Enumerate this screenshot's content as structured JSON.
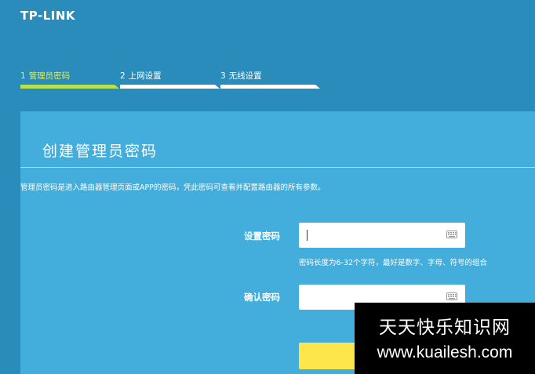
{
  "brand": {
    "logo_text": "TP-LINK"
  },
  "steps": [
    {
      "number": "1",
      "label": "管理员密码",
      "active": true
    },
    {
      "number": "2",
      "label": "上网设置",
      "active": false
    },
    {
      "number": "3",
      "label": "无线设置",
      "active": false
    }
  ],
  "panel": {
    "title": "创建管理员密码",
    "description": "管理员密码是进入路由器管理页面或APP的密码，凭此密码可查看并配置路由器的所有参数。",
    "fields": {
      "set_password": {
        "label": "设置密码",
        "value": "",
        "hint": "密码长度为6-32个字符，最好是数字、字母、符号的组合"
      },
      "confirm_password": {
        "label": "确认密码",
        "value": ""
      }
    }
  },
  "watermark": {
    "line1": "天天快乐知识网",
    "line2": "www.kuailesh.com"
  },
  "colors": {
    "page_background": "#2a8cbb",
    "panel_background": "#43aedb",
    "active_step": "#b7e34a",
    "active_step_text": "#d7ef6a",
    "button": "#fde64b",
    "watermark_background": "#000000"
  },
  "icons": {
    "field_trailing": "keyboard-icon"
  }
}
